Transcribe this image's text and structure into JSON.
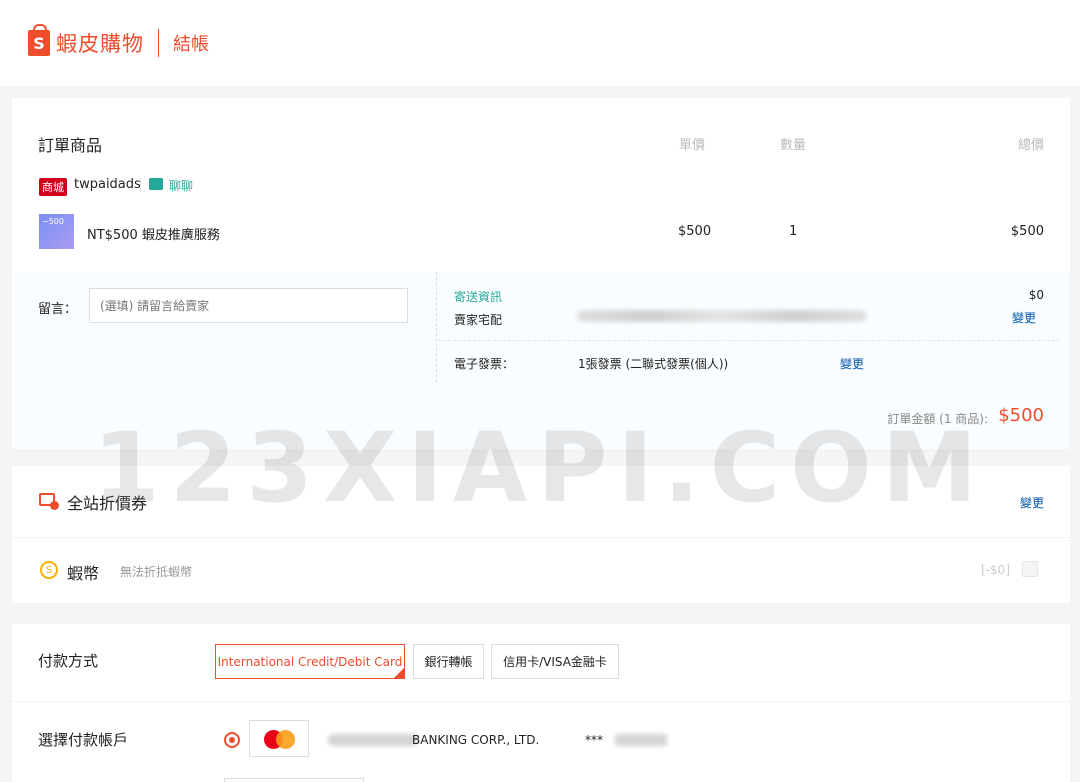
{
  "header": {
    "logo_letter": "S",
    "brand": "蝦皮購物",
    "page": "結帳"
  },
  "order": {
    "title": "訂單商品",
    "columns": {
      "unit_price": "單價",
      "qty": "數量",
      "subtotal": "總價"
    },
    "shop": {
      "badge": "商城",
      "name": "twpaidads",
      "chat": "聊聊"
    },
    "item": {
      "thumb_text": "~500",
      "name": "NT$500 蝦皮推廣服務",
      "price": "$500",
      "qty": "1",
      "total": "$500"
    },
    "message": {
      "label": "留言：",
      "placeholder": "(選填) 請留言給賣家"
    },
    "shipping": {
      "info_label": "寄送資訊",
      "type": "賣家宅配",
      "fee": "$0",
      "change": "變更"
    },
    "invoice": {
      "label": "電子發票：",
      "value": "1張發票 (二聯式發票(個人))",
      "change": "變更"
    },
    "total": {
      "label": "訂單金額 (1 商品):",
      "value": "$500"
    }
  },
  "discount": {
    "voucher_label": "全站折價券",
    "voucher_change": "變更",
    "coin_symbol": "S",
    "coin_label": "蝦幣",
    "coin_note": "無法折抵蝦幣",
    "coin_value": "[-$0]"
  },
  "payment": {
    "label": "付款方式",
    "options": [
      "International Credit/Debit Card",
      "銀行轉帳",
      "信用卡/VISA金融卡"
    ],
    "account_label": "選擇付款帳戶",
    "bank_name": "BANKING CORP., LTD.",
    "card_mask": "***"
  },
  "watermark": "123XIAPI.COM",
  "colors": {
    "brand": "#ee4d2d",
    "link": "#0055aa",
    "teal": "#26aa99"
  }
}
